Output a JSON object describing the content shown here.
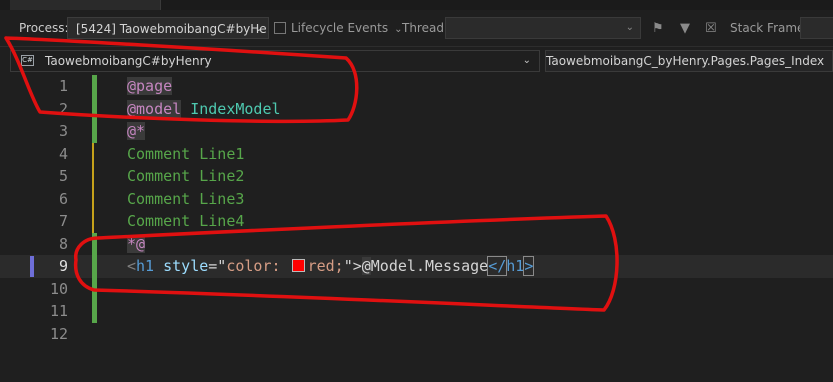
{
  "toolbar": {
    "process_label": "Process:",
    "process_value": "[5424] TaowebmoibangC#byHe",
    "lifecycle_label": "Lifecycle Events",
    "thread_label": "Thread:",
    "thread_value": "",
    "stack_label": "Stack Frame:"
  },
  "navbar": {
    "project": "TaowebmoibangC#byHenry",
    "member": "TaowebmoibangC_byHenry.Pages.Pages_Index",
    "project_icon": "C#"
  },
  "editor": {
    "current_line": 9,
    "lines": [
      {
        "num": "1",
        "code": "@page"
      },
      {
        "num": "2",
        "code": "@model IndexModel"
      },
      {
        "num": "3",
        "code": "@*"
      },
      {
        "num": "4",
        "code": "Comment Line1"
      },
      {
        "num": "5",
        "code": "Comment Line2"
      },
      {
        "num": "6",
        "code": "Comment Line3"
      },
      {
        "num": "7",
        "code": "Comment Line4"
      },
      {
        "num": "8",
        "code": "*@"
      },
      {
        "num": "9",
        "code": "<h1 style=\"color: red;\">@Model.Message</h1>"
      },
      {
        "num": "10",
        "code": ""
      },
      {
        "num": "11",
        "code": ""
      },
      {
        "num": "12",
        "code": ""
      }
    ],
    "tokens": {
      "l1_dir": "@page",
      "l2_dir": "@model",
      "l2_type": "IndexModel",
      "l3": "@*",
      "l4": "Comment Line1",
      "l5": "Comment Line2",
      "l6": "Comment Line3",
      "l7": "Comment Line4",
      "l8": "*@",
      "l9_open_lt": "<",
      "l9_el": "h1",
      "l9_attr": "style",
      "l9_eq": "=\"",
      "l9_str1": "color:",
      "l9_str2": "red;",
      "l9_q": "\">",
      "l9_at": "@",
      "l9_model": "Model",
      "l9_dot": ".",
      "l9_msg": "Message",
      "l9_close_lt": "</",
      "l9_close_el": "h1",
      "l9_close_gt": ">"
    }
  },
  "colors": {
    "swatch": "#ff0000",
    "annotation": "#e01010",
    "change_bar": "#57a64a"
  },
  "icons": {
    "lifecycle": "lifecycle-events-icon",
    "flag": "flag-icon",
    "filter": "filter-icon",
    "clear": "clear-filter-icon"
  }
}
